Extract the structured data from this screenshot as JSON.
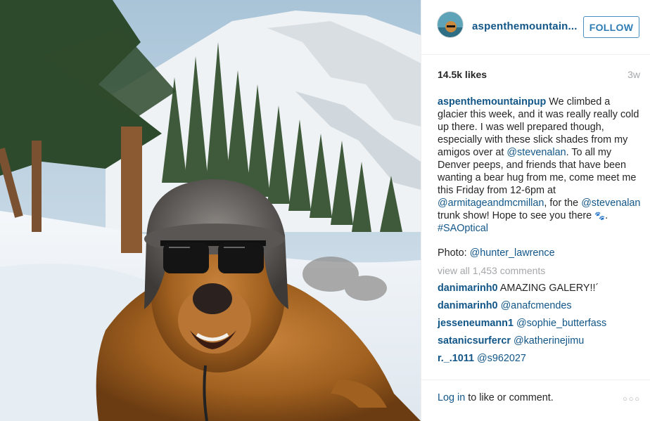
{
  "post": {
    "username": "aspenthemountain...",
    "follow_label": "FOLLOW",
    "likes": "14.5k likes",
    "time_ago": "3w",
    "caption": {
      "user": "aspenthemountainpup",
      "part1": " We climbed a glacier this week, and it was really really cold up there. I was well prepared though, especially with these slick shades from my amigos over at ",
      "mention1": "@stevenalan",
      "part2": ". To all my Denver peeps, and friends that have been wanting a bear hug from me, come meet me this Friday from 12-6pm at ",
      "mention2": "@armitageandmcmillan",
      "part3": ", for the ",
      "mention3": "@stevenalan",
      "part4": " trunk show! Hope to see you there ",
      "paws": "🐾",
      "part5": ". ",
      "hashtag": "#SAOptical"
    },
    "photo_credit_label": "Photo: ",
    "photo_credit_user": "@hunter_lawrence",
    "view_all": "view all 1,453 comments",
    "comments": [
      {
        "user": "danimarinh0",
        "text": " AMAZING GALERY!!´",
        "mention": ""
      },
      {
        "user": "danimarinh0",
        "text": " ",
        "mention": "@anafcmendes"
      },
      {
        "user": "jesseneumann1",
        "text": " ",
        "mention": "@sophie_butterfass"
      },
      {
        "user": "satanicsurfercr",
        "text": " ",
        "mention": "@katherinejimu"
      },
      {
        "user": "r._.1011",
        "text": " ",
        "mention": "@s962027"
      }
    ],
    "footer": {
      "login_link": "Log in",
      "login_rest": " to like or comment.",
      "more": "○○○"
    }
  },
  "icons": [
    "more-options-icon"
  ],
  "colors": {
    "link": "#125688",
    "follow": "#2d7cb4",
    "muted": "#a5a7aa",
    "text": "#262626"
  }
}
